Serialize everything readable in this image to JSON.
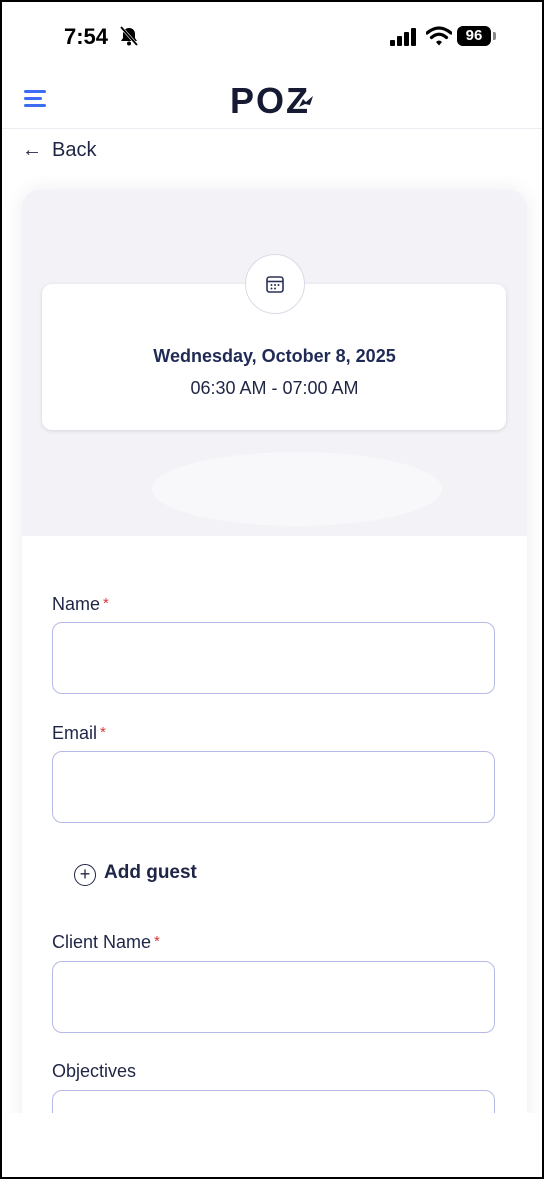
{
  "status_bar": {
    "time": "7:54",
    "battery": "96"
  },
  "header": {
    "logo": "POZ"
  },
  "nav": {
    "back_label": "Back"
  },
  "booking": {
    "date": "Wednesday, October 8, 2025",
    "time_range": "06:30 AM - 07:00 AM"
  },
  "form": {
    "required_marker": "*",
    "name_label": "Name",
    "email_label": "Email",
    "add_guest_label": "Add guest",
    "client_name_label": "Client Name",
    "objectives_label": "Objectives",
    "name_value": "",
    "email_value": "",
    "client_name_value": "",
    "objectives_value": ""
  },
  "icons": {
    "menu": "hamburger-menu-icon",
    "back": "arrow-left-icon",
    "calendar": "calendar-icon",
    "add": "plus-circle-icon"
  },
  "colors": {
    "accent": "#3d6df5",
    "required": "#d53a3a",
    "field_border": "#b6b9e6",
    "text": "#1f2544"
  }
}
